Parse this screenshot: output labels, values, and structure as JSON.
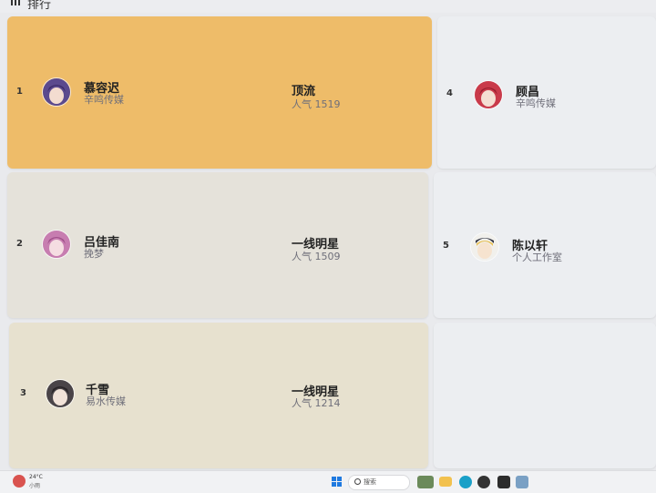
{
  "header": {
    "title": "排行"
  },
  "entries": [
    {
      "rank": "1",
      "name": "慕容迟",
      "agency": "辛鸣传媒",
      "tier": "顶流",
      "popularity": "人气 1519",
      "color": "#eebc69"
    },
    {
      "rank": "2",
      "name": "吕佳南",
      "agency": "挽梦",
      "tier": "一线明星",
      "popularity": "人气 1509",
      "color": "#e5e2da"
    },
    {
      "rank": "3",
      "name": "千雪",
      "agency": "易水传媒",
      "tier": "一线明星",
      "popularity": "人气 1214",
      "color": "#e7e1cf"
    },
    {
      "rank": "4",
      "name": "顾昌",
      "agency": "辛鸣传媒",
      "color": "#eceef1"
    },
    {
      "rank": "5",
      "name": "陈以轩",
      "agency": "个人工作室",
      "color": "#eceef1"
    }
  ],
  "taskbar": {
    "temperature": "24°C",
    "condition": "小雨",
    "search_label": "搜索"
  }
}
